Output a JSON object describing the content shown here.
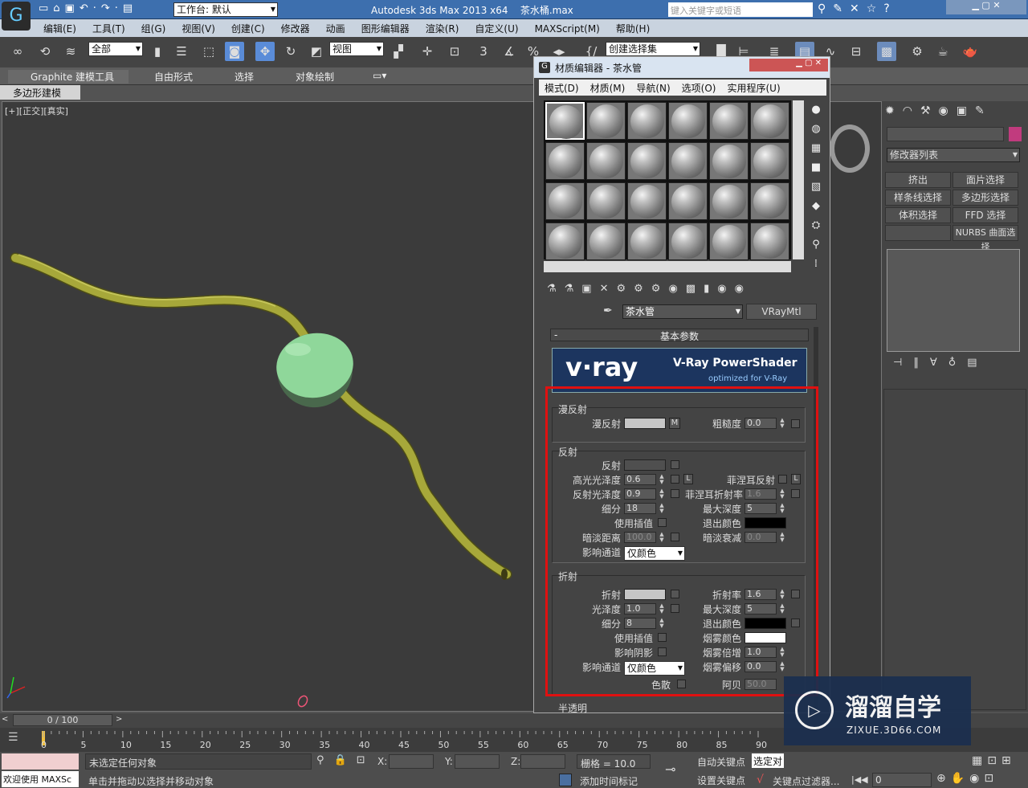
{
  "title_bar": {
    "workspace": "工作台: 默认",
    "app": "Autodesk 3ds Max  2013 x64",
    "file": "茶水桶.max",
    "search_placeholder": "键入关键字或短语"
  },
  "menu": [
    "编辑(E)",
    "工具(T)",
    "组(G)",
    "视图(V)",
    "创建(C)",
    "修改器",
    "动画",
    "图形编辑器",
    "渲染(R)",
    "自定义(U)",
    "MAXScript(M)",
    "帮助(H)"
  ],
  "toolbar": {
    "selection_filter": "全部",
    "ref_coord": "视图",
    "named_selection": "创建选择集",
    "snap_num": "3"
  },
  "ribbon": {
    "tabs": [
      "Graphite 建模工具",
      "自由形式",
      "选择",
      "对象绘制"
    ],
    "sub": "多边形建模"
  },
  "viewport": {
    "label": "[+][正交][真实]"
  },
  "material_editor": {
    "title": "材质编辑器 - 茶水管",
    "menu": [
      "模式(D)",
      "材质(M)",
      "导航(N)",
      "选项(O)",
      "实用程序(U)"
    ],
    "material_name": "茶水管",
    "material_type": "VRayMtl",
    "rollout": "基本参数",
    "banner": {
      "brand": "v·ray",
      "product": "V-Ray PowerShader",
      "sub": "optimized for V-Ray"
    },
    "diffuse": {
      "group": "漫反射",
      "diffuse_label": "漫反射",
      "m": "M",
      "roughness_label": "粗糙度",
      "roughness": "0.0"
    },
    "reflection": {
      "group": "反射",
      "reflect": "反射",
      "hilight_gloss": "高光光泽度",
      "hilight_val": "0.6",
      "l": "L",
      "fresnel": "菲涅耳反射",
      "refl_gloss": "反射光泽度",
      "refl_val": "0.9",
      "fresnel_ior": "菲涅耳折射率",
      "fresnel_ior_val": "1.6",
      "subdivs": "细分",
      "subdivs_val": "18",
      "max_depth": "最大深度",
      "max_depth_val": "5",
      "use_interp": "使用插值",
      "exit_color": "退出颜色",
      "dim_dist": "暗淡距离",
      "dim_dist_val": "100.0",
      "dim_falloff": "暗淡衰减",
      "dim_falloff_val": "0.0",
      "affect_ch": "影响通道",
      "affect_ch_val": "仅颜色"
    },
    "refraction": {
      "group": "折射",
      "refract": "折射",
      "ior": "折射率",
      "ior_val": "1.6",
      "gloss": "光泽度",
      "gloss_val": "1.0",
      "max_depth": "最大深度",
      "max_depth_val": "5",
      "subdivs": "细分",
      "subdivs_val": "8",
      "exit_color": "退出颜色",
      "use_interp": "使用插值",
      "fog_color": "烟雾颜色",
      "affect_shadows": "影响阴影",
      "fog_mult": "烟雾倍增",
      "fog_mult_val": "1.0",
      "affect_ch": "影响通道",
      "affect_ch_val": "仅颜色",
      "fog_bias": "烟雾偏移",
      "fog_bias_val": "0.0",
      "dispersion": "色散",
      "abbe": "阿贝",
      "abbe_val": "50.0"
    },
    "next_group": "半透明"
  },
  "right_panel": {
    "modifier_list": "修改器列表",
    "buttons": [
      "挤出",
      "面片选择",
      "样条线选择",
      "多边形选择",
      "体积选择",
      "FFD 选择",
      "",
      "NURBS 曲面选择"
    ]
  },
  "timeline": {
    "frame": "0 / 100",
    "ticks": [
      "0",
      "5",
      "10",
      "15",
      "20",
      "25",
      "30",
      "35",
      "40",
      "45",
      "50",
      "55",
      "60",
      "65",
      "70",
      "75",
      "80",
      "85",
      "90"
    ]
  },
  "status": {
    "welcome": "欢迎使用 MAXSc",
    "no_selection": "未选定任何对象",
    "prompt": "单击并拖动以选择并移动对象",
    "x": "X:",
    "y": "Y:",
    "z": "Z:",
    "grid": "栅格 = 10.0",
    "add_time_tag": "添加时间标记",
    "auto_key": "自动关键点",
    "set_key": "设置关键点",
    "selected": "选定对",
    "key_filter": "关键点过滤器...",
    "frame_val": "0"
  },
  "watermark": {
    "name": "溜溜自学",
    "url": "ZIXUE.3D66.COM"
  },
  "colors": {
    "tube": "#a7a83a",
    "bulb": "#8fd79a",
    "highlight": "#e01010"
  }
}
